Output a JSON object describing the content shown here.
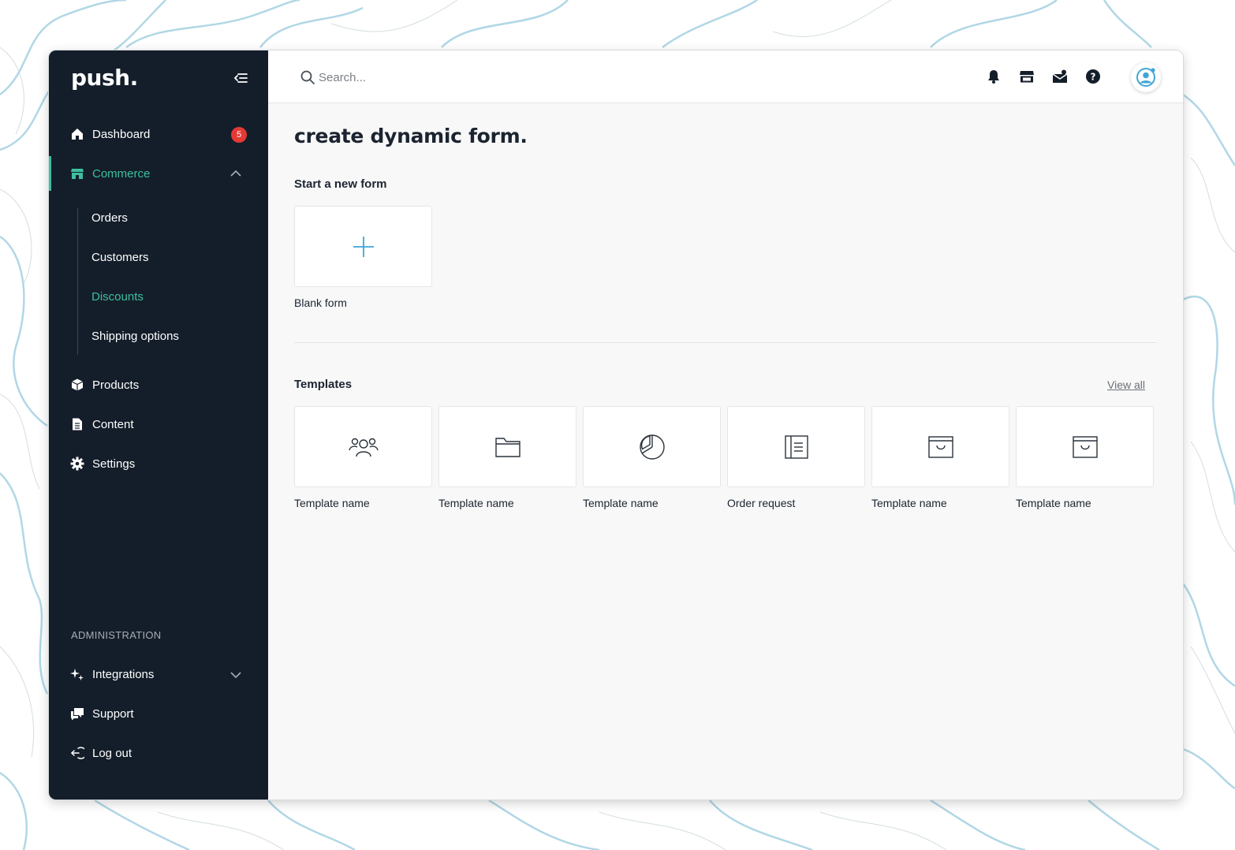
{
  "colors": {
    "sidebar_bg": "#141e2a",
    "accent": "#3dbf9e",
    "badge": "#e53935",
    "plus": "#3fa6d6"
  },
  "sidebar": {
    "logo": "push.",
    "items": [
      {
        "label": "Dashboard",
        "icon": "home-icon",
        "badge": "5"
      },
      {
        "label": "Commerce",
        "icon": "store-icon",
        "expanded": true,
        "active": true
      },
      {
        "label": "Products",
        "icon": "box-icon"
      },
      {
        "label": "Content",
        "icon": "document-icon"
      },
      {
        "label": "Settings",
        "icon": "gear-icon"
      }
    ],
    "commerce_sub": [
      {
        "label": "Orders"
      },
      {
        "label": "Customers"
      },
      {
        "label": "Discounts",
        "active": true
      },
      {
        "label": "Shipping options"
      }
    ],
    "admin_heading": "ADMINISTRATION",
    "admin_items": [
      {
        "label": "Integrations",
        "icon": "sparkle-icon"
      },
      {
        "label": "Support",
        "icon": "chat-icon"
      },
      {
        "label": "Log out",
        "icon": "logout-icon"
      }
    ]
  },
  "topbar": {
    "search_placeholder": "Search...",
    "icons": [
      "bell-icon",
      "store-icon",
      "inbox-icon",
      "help-icon",
      "user-avatar-icon"
    ]
  },
  "main": {
    "title": "create dynamic form.",
    "new_form_heading": "Start a new form",
    "blank_form_label": "Blank form",
    "templates_heading": "Templates",
    "view_all": "View all",
    "templates": [
      {
        "label": "Template name",
        "icon": "users-icon"
      },
      {
        "label": "Template name",
        "icon": "folder-icon"
      },
      {
        "label": "Template name",
        "icon": "pie-chart-icon"
      },
      {
        "label": "Order request",
        "icon": "form-doc-icon"
      },
      {
        "label": "Template name",
        "icon": "archive-box-icon"
      },
      {
        "label": "Template name",
        "icon": "archive-box-icon"
      }
    ]
  }
}
